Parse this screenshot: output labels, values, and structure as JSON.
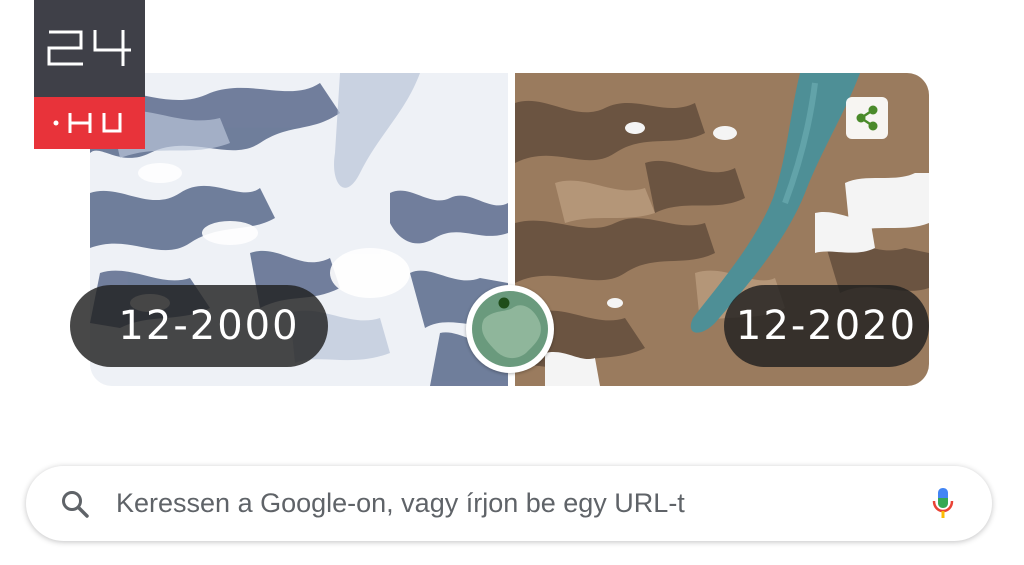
{
  "logo": {
    "number": "24",
    "suffix": "·HU",
    "top_color": "#3f4048",
    "bottom_color": "#e8333a"
  },
  "doodle": {
    "before_label": "12-2000",
    "after_label": "12-2020",
    "share_icon": "share-icon",
    "globe_icon": "globe-icon",
    "accent": "#4a8a2a"
  },
  "search": {
    "placeholder": "Keressen a Google-on, vagy írjon be egy URL-t",
    "search_icon": "search-icon",
    "mic_icon": "mic-icon"
  }
}
